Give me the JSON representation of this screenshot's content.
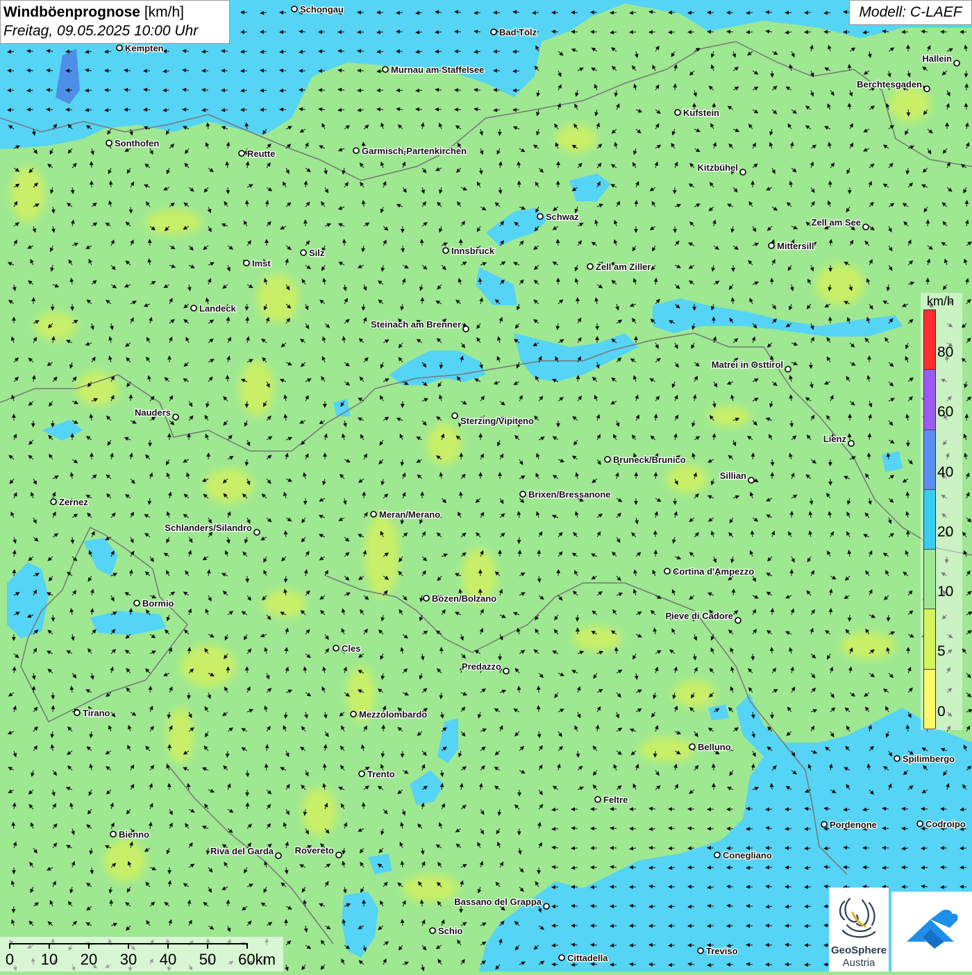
{
  "title": {
    "bold": "Windböenprognose",
    "unit": "[km/h]",
    "datetime": "Freitag, 09.05.2025 10:00 Uhr"
  },
  "model": "Modell: C-LAEF",
  "legend": {
    "unit": "km/h",
    "labels": [
      "80",
      "60",
      "40",
      "20",
      "10",
      "5",
      "0"
    ],
    "colors": [
      "#ff2d2d",
      "#9b5bf0",
      "#5b8ef0",
      "#38cdf0",
      "#9ee892",
      "#d6f55c",
      "#fff86a"
    ]
  },
  "scale": {
    "labels": [
      "0",
      "10",
      "20",
      "30",
      "40",
      "50",
      "60km"
    ]
  },
  "branding": {
    "name": "GeoSphere",
    "country": "Austria"
  },
  "cities": [
    {
      "name": "Schongau"
    },
    {
      "name": "Bad Tölz"
    },
    {
      "name": "Kempten"
    },
    {
      "name": "Murnau am Staffelsee"
    },
    {
      "name": "Hallein"
    },
    {
      "name": "Berchtesgaden"
    },
    {
      "name": "Kufstein"
    },
    {
      "name": "Sonthofen"
    },
    {
      "name": "Reutte"
    },
    {
      "name": "Garmisch-Partenkirchen"
    },
    {
      "name": "Kitzbühel"
    },
    {
      "name": "Schwaz"
    },
    {
      "name": "Zell am See"
    },
    {
      "name": "Mittersill"
    },
    {
      "name": "Innsbruck"
    },
    {
      "name": "Silz"
    },
    {
      "name": "Imst"
    },
    {
      "name": "Zell am Ziller"
    },
    {
      "name": "Landeck"
    },
    {
      "name": "Steinach am Brenner"
    },
    {
      "name": "Matrei in Osttirol"
    },
    {
      "name": "Nauders"
    },
    {
      "name": "Sterzing/Vipiteno"
    },
    {
      "name": "Lienz"
    },
    {
      "name": "Bruneck/Brunico"
    },
    {
      "name": "Sillian"
    },
    {
      "name": "Zernez"
    },
    {
      "name": "Brixen/Bressanone"
    },
    {
      "name": "Meran/Merano"
    },
    {
      "name": "Schlanders/Silandro"
    },
    {
      "name": "Cortina d'Ampezzo"
    },
    {
      "name": "Bozen/Bolzano"
    },
    {
      "name": "Bormio"
    },
    {
      "name": "Pieve di Cadore"
    },
    {
      "name": "Cles"
    },
    {
      "name": "Predazzo"
    },
    {
      "name": "Tirano"
    },
    {
      "name": "Mezzolombardo"
    },
    {
      "name": "Belluno"
    },
    {
      "name": "Spilimbergo"
    },
    {
      "name": "Trento"
    },
    {
      "name": "Feltre"
    },
    {
      "name": "Pordenone"
    },
    {
      "name": "Codroipo"
    },
    {
      "name": "Bienno"
    },
    {
      "name": "Riva del Garda"
    },
    {
      "name": "Rovereto"
    },
    {
      "name": "Conegliano"
    },
    {
      "name": "Bassano del Grappa"
    },
    {
      "name": "Schio"
    },
    {
      "name": "Treviso"
    },
    {
      "name": "Cittadella"
    }
  ]
}
